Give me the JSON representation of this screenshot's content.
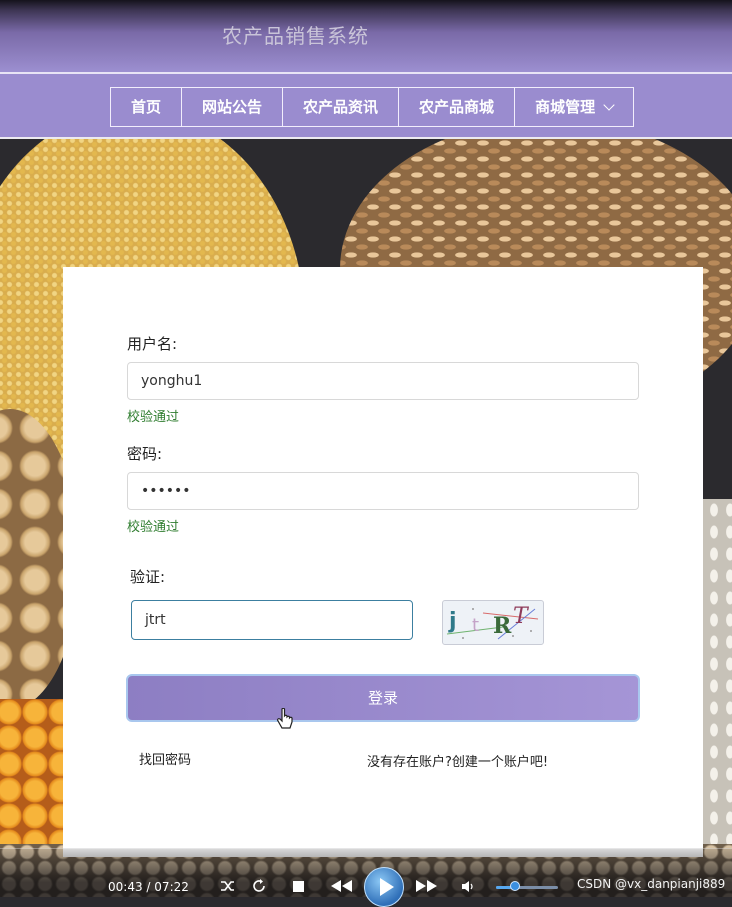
{
  "header": {
    "site_title": "农产品销售系统"
  },
  "nav": {
    "items": [
      {
        "label": "首页"
      },
      {
        "label": "网站公告"
      },
      {
        "label": "农产品资讯"
      },
      {
        "label": "农产品商城"
      },
      {
        "label": "商城管理"
      }
    ]
  },
  "login": {
    "username_label": "用户名:",
    "username_value": "yonghu1",
    "username_status": "校验通过",
    "password_label": "密码:",
    "password_value": "••••••",
    "password_status": "校验通过",
    "captcha_label": "验证:",
    "captcha_value": "jtrt",
    "captcha_image_text": "jtRT",
    "submit_label": "登录",
    "forgot_link": "找回密码",
    "register_link": "没有存在账户?创建一个账户吧!"
  },
  "player": {
    "current_time": "00:43",
    "total_time": "07:22",
    "time_separator": "/",
    "volume_level": 0.3
  },
  "watermark": "CSDN @vx_danpianji889",
  "colors": {
    "nav_bg": "#9a8ccf",
    "button_bg": "#9787cc",
    "status_ok": "#2f7d2f"
  }
}
